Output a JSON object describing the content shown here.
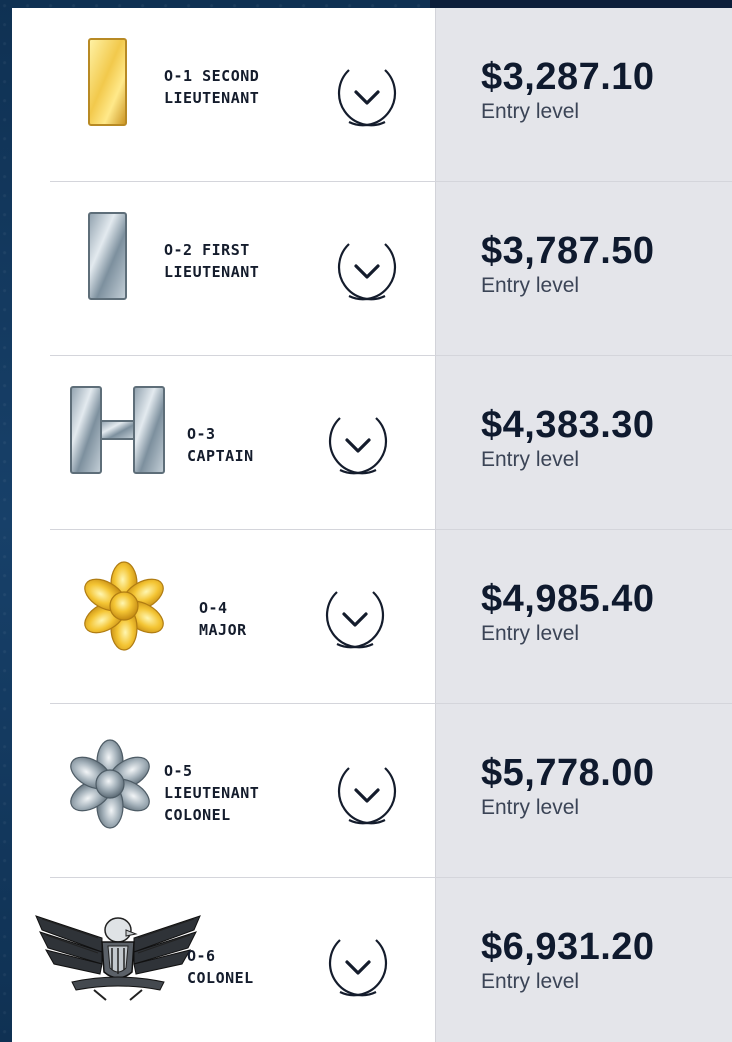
{
  "ranks": [
    {
      "rank": "O-1 SECOND\nLIEUTENANT",
      "pay": "$3,287.10",
      "note": "Entry level",
      "insignia": "gold-bar-icon"
    },
    {
      "rank": "O-2 FIRST\nLIEUTENANT",
      "pay": "$3,787.50",
      "note": "Entry level",
      "insignia": "silver-bar-icon"
    },
    {
      "rank": "O-3\nCAPTAIN",
      "pay": "$4,383.30",
      "note": "Entry level",
      "insignia": "double-silver-bar-icon"
    },
    {
      "rank": "O-4\nMAJOR",
      "pay": "$4,985.40",
      "note": "Entry level",
      "insignia": "gold-oak-leaf-icon"
    },
    {
      "rank": "O-5\nLIEUTENANT\nCOLONEL",
      "pay": "$5,778.00",
      "note": "Entry level",
      "insignia": "silver-oak-leaf-icon"
    },
    {
      "rank": "O-6\nCOLONEL",
      "pay": "$6,931.20",
      "note": "Entry level",
      "insignia": "eagle-icon"
    }
  ],
  "colors": {
    "background": "#13375a",
    "panel": "#ffffff",
    "pay_column": "#e4e5ea",
    "text": "#141c2c"
  }
}
